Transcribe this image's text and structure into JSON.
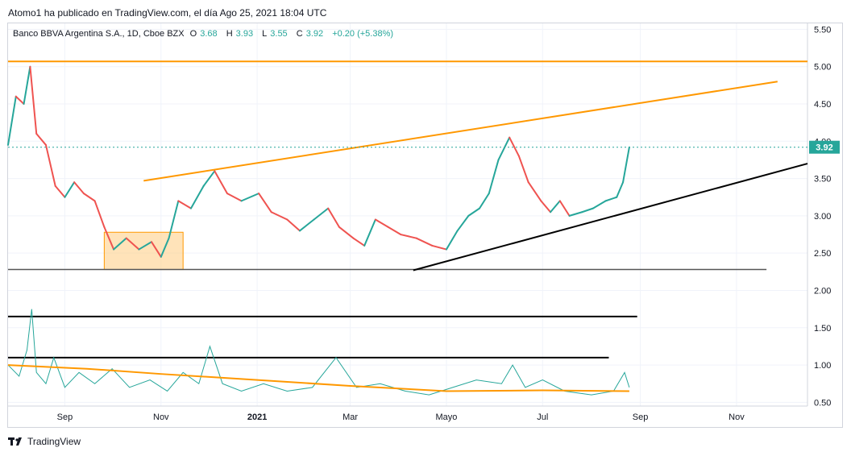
{
  "header": {
    "published": "Atomo1 ha publicado en TradingView.com, el día Ago 25, 2021 18:04 UTC"
  },
  "legend": {
    "symbol": "Banco BBVA Argentina S.A., 1D, Cboe BZX",
    "o_label": "O",
    "o_value": "3.68",
    "h_label": "H",
    "h_value": "3.93",
    "l_label": "L",
    "l_value": "3.55",
    "c_label": "C",
    "c_value": "3.92",
    "change": "+0.20 (+5.38%)"
  },
  "footer": {
    "brand": "TradingView"
  },
  "colors": {
    "up": "#26a69a",
    "down": "#ef5350",
    "orange": "#ff9800",
    "teal_line": "#26a69a",
    "grid": "#f0f3fa",
    "box_fill": "#ffcc80"
  },
  "chart_data": {
    "type": "line",
    "title": "Banco BBVA Argentina S.A., 1D, Cboe BZX",
    "y_ticks": [
      "5.50",
      "5.00",
      "4.50",
      "4.00",
      "3.50",
      "3.00",
      "2.50",
      "2.00",
      "1.50",
      "1.00",
      "0.50"
    ],
    "ylim": [
      0.45,
      5.58
    ],
    "x_ticks": [
      "Sep",
      "Nov",
      "2021",
      "Mar",
      "Mayo",
      "Jul",
      "Sep",
      "Nov"
    ],
    "x_tick_dates": [
      "2020-09-01",
      "2020-11-01",
      "2021-01-01",
      "2021-03-01",
      "2021-05-01",
      "2021-07-01",
      "2021-09-01",
      "2021-11-01"
    ],
    "xlim": [
      "2020-07-27",
      "2021-12-16"
    ],
    "last_price": "3.92",
    "price_path": [
      {
        "d": "2020-07-27",
        "v": 3.95
      },
      {
        "d": "2020-08-01",
        "v": 4.6
      },
      {
        "d": "2020-08-06",
        "v": 4.5
      },
      {
        "d": "2020-08-10",
        "v": 5.0
      },
      {
        "d": "2020-08-14",
        "v": 4.1
      },
      {
        "d": "2020-08-20",
        "v": 3.95
      },
      {
        "d": "2020-08-26",
        "v": 3.4
      },
      {
        "d": "2020-09-01",
        "v": 3.25
      },
      {
        "d": "2020-09-07",
        "v": 3.45
      },
      {
        "d": "2020-09-13",
        "v": 3.3
      },
      {
        "d": "2020-09-20",
        "v": 3.2
      },
      {
        "d": "2020-09-26",
        "v": 2.85
      },
      {
        "d": "2020-10-02",
        "v": 2.55
      },
      {
        "d": "2020-10-10",
        "v": 2.7
      },
      {
        "d": "2020-10-18",
        "v": 2.55
      },
      {
        "d": "2020-10-26",
        "v": 2.65
      },
      {
        "d": "2020-11-01",
        "v": 2.45
      },
      {
        "d": "2020-11-06",
        "v": 2.7
      },
      {
        "d": "2020-11-12",
        "v": 3.2
      },
      {
        "d": "2020-11-20",
        "v": 3.1
      },
      {
        "d": "2020-11-28",
        "v": 3.4
      },
      {
        "d": "2020-12-05",
        "v": 3.6
      },
      {
        "d": "2020-12-13",
        "v": 3.3
      },
      {
        "d": "2020-12-22",
        "v": 3.2
      },
      {
        "d": "2021-01-02",
        "v": 3.3
      },
      {
        "d": "2021-01-10",
        "v": 3.05
      },
      {
        "d": "2021-01-20",
        "v": 2.95
      },
      {
        "d": "2021-01-28",
        "v": 2.8
      },
      {
        "d": "2021-02-06",
        "v": 2.95
      },
      {
        "d": "2021-02-15",
        "v": 3.1
      },
      {
        "d": "2021-02-22",
        "v": 2.85
      },
      {
        "d": "2021-03-03",
        "v": 2.7
      },
      {
        "d": "2021-03-10",
        "v": 2.6
      },
      {
        "d": "2021-03-17",
        "v": 2.95
      },
      {
        "d": "2021-03-25",
        "v": 2.85
      },
      {
        "d": "2021-04-02",
        "v": 2.75
      },
      {
        "d": "2021-04-12",
        "v": 2.7
      },
      {
        "d": "2021-04-22",
        "v": 2.6
      },
      {
        "d": "2021-05-01",
        "v": 2.55
      },
      {
        "d": "2021-05-08",
        "v": 2.8
      },
      {
        "d": "2021-05-15",
        "v": 3.0
      },
      {
        "d": "2021-05-22",
        "v": 3.1
      },
      {
        "d": "2021-05-28",
        "v": 3.3
      },
      {
        "d": "2021-06-03",
        "v": 3.75
      },
      {
        "d": "2021-06-10",
        "v": 4.05
      },
      {
        "d": "2021-06-16",
        "v": 3.8
      },
      {
        "d": "2021-06-22",
        "v": 3.45
      },
      {
        "d": "2021-06-30",
        "v": 3.2
      },
      {
        "d": "2021-07-06",
        "v": 3.05
      },
      {
        "d": "2021-07-12",
        "v": 3.2
      },
      {
        "d": "2021-07-18",
        "v": 3.0
      },
      {
        "d": "2021-07-26",
        "v": 3.05
      },
      {
        "d": "2021-08-02",
        "v": 3.1
      },
      {
        "d": "2021-08-10",
        "v": 3.2
      },
      {
        "d": "2021-08-17",
        "v": 3.25
      },
      {
        "d": "2021-08-21",
        "v": 3.45
      },
      {
        "d": "2021-08-25",
        "v": 3.92
      }
    ],
    "volume_path": [
      {
        "d": "2020-07-27",
        "v": 1.0
      },
      {
        "d": "2020-08-03",
        "v": 0.85
      },
      {
        "d": "2020-08-08",
        "v": 1.2
      },
      {
        "d": "2020-08-11",
        "v": 1.75
      },
      {
        "d": "2020-08-14",
        "v": 0.9
      },
      {
        "d": "2020-08-20",
        "v": 0.75
      },
      {
        "d": "2020-08-25",
        "v": 1.1
      },
      {
        "d": "2020-09-01",
        "v": 0.7
      },
      {
        "d": "2020-09-10",
        "v": 0.9
      },
      {
        "d": "2020-09-20",
        "v": 0.75
      },
      {
        "d": "2020-10-01",
        "v": 0.95
      },
      {
        "d": "2020-10-12",
        "v": 0.7
      },
      {
        "d": "2020-10-25",
        "v": 0.8
      },
      {
        "d": "2020-11-05",
        "v": 0.65
      },
      {
        "d": "2020-11-15",
        "v": 0.9
      },
      {
        "d": "2020-11-25",
        "v": 0.75
      },
      {
        "d": "2020-12-02",
        "v": 1.25
      },
      {
        "d": "2020-12-10",
        "v": 0.75
      },
      {
        "d": "2020-12-22",
        "v": 0.65
      },
      {
        "d": "2021-01-05",
        "v": 0.75
      },
      {
        "d": "2021-01-20",
        "v": 0.65
      },
      {
        "d": "2021-02-05",
        "v": 0.7
      },
      {
        "d": "2021-02-20",
        "v": 1.1
      },
      {
        "d": "2021-03-05",
        "v": 0.7
      },
      {
        "d": "2021-03-20",
        "v": 0.75
      },
      {
        "d": "2021-04-05",
        "v": 0.65
      },
      {
        "d": "2021-04-20",
        "v": 0.6
      },
      {
        "d": "2021-05-05",
        "v": 0.7
      },
      {
        "d": "2021-05-20",
        "v": 0.8
      },
      {
        "d": "2021-06-05",
        "v": 0.75
      },
      {
        "d": "2021-06-12",
        "v": 1.0
      },
      {
        "d": "2021-06-20",
        "v": 0.7
      },
      {
        "d": "2021-07-01",
        "v": 0.8
      },
      {
        "d": "2021-07-15",
        "v": 0.65
      },
      {
        "d": "2021-08-01",
        "v": 0.6
      },
      {
        "d": "2021-08-15",
        "v": 0.65
      },
      {
        "d": "2021-08-22",
        "v": 0.9
      },
      {
        "d": "2021-08-25",
        "v": 0.7
      }
    ],
    "volume_ma_path": [
      {
        "d": "2020-07-27",
        "v": 1.0
      },
      {
        "d": "2020-09-15",
        "v": 0.95
      },
      {
        "d": "2020-11-01",
        "v": 0.88
      },
      {
        "d": "2021-01-01",
        "v": 0.8
      },
      {
        "d": "2021-03-01",
        "v": 0.72
      },
      {
        "d": "2021-05-01",
        "v": 0.65
      },
      {
        "d": "2021-07-01",
        "v": 0.66
      },
      {
        "d": "2021-08-25",
        "v": 0.65
      }
    ],
    "drawings": {
      "hline_top": {
        "y": 5.07,
        "from": "2020-07-27",
        "to": "2021-12-16"
      },
      "support_2_28": {
        "y": 2.28,
        "from": "2020-07-27",
        "to": "2021-11-20"
      },
      "black_line_1_65": {
        "y": 1.65,
        "from": "2020-07-27",
        "to": "2021-08-30"
      },
      "black_line_1_10": {
        "y": 1.1,
        "from": "2020-07-27",
        "to": "2021-08-12"
      },
      "upper_trend": {
        "from": {
          "d": "2020-10-21",
          "y": 3.47
        },
        "to": {
          "d": "2021-11-27",
          "y": 4.8
        }
      },
      "lower_trend": {
        "from": {
          "d": "2021-04-10",
          "y": 2.27
        },
        "to": {
          "d": "2021-12-16",
          "y": 3.7
        }
      },
      "box": {
        "from": "2020-09-26",
        "to": "2020-11-15",
        "y_low": 2.28,
        "y_high": 2.78
      }
    }
  }
}
